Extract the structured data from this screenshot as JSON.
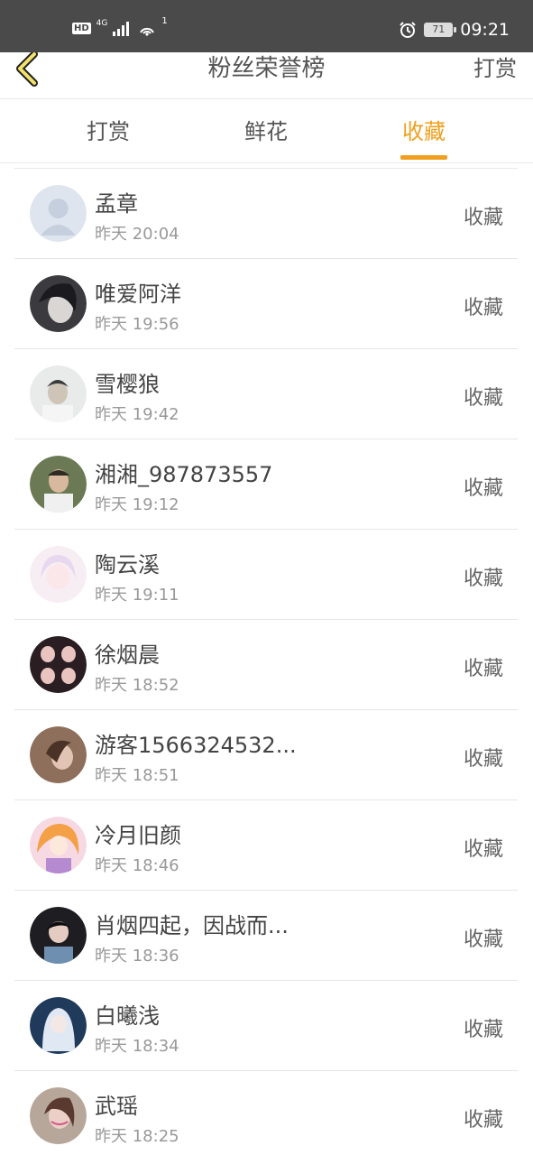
{
  "status_bar": {
    "network_badge": "HD",
    "network_type": "4G",
    "hotspot_count": "1",
    "battery_level": "71",
    "time": "09:21"
  },
  "nav": {
    "title": "粉丝荣誉榜",
    "right_action": "打赏"
  },
  "tabs": [
    {
      "label": "打赏",
      "active": false
    },
    {
      "label": "鲜花",
      "active": false
    },
    {
      "label": "收藏",
      "active": true
    }
  ],
  "accent_color": "#f0a01e",
  "list": [
    {
      "name": "孟章",
      "time": "昨天 20:04",
      "action": "收藏",
      "avatar": "default-avatar"
    },
    {
      "name": "唯爱阿洋",
      "time": "昨天 19:56",
      "action": "收藏",
      "avatar": "user-photo"
    },
    {
      "name": "雪樱狼",
      "time": "昨天 19:42",
      "action": "收藏",
      "avatar": "user-photo"
    },
    {
      "name": "湘湘_987873557",
      "time": "昨天 19:12",
      "action": "收藏",
      "avatar": "user-photo"
    },
    {
      "name": "陶云溪",
      "time": "昨天 19:11",
      "action": "收藏",
      "avatar": "user-photo"
    },
    {
      "name": "徐烟晨",
      "time": "昨天 18:52",
      "action": "收藏",
      "avatar": "user-photo"
    },
    {
      "name": "游客1566324532...",
      "time": "昨天 18:51",
      "action": "收藏",
      "avatar": "user-photo"
    },
    {
      "name": "冷月旧颜",
      "time": "昨天 18:46",
      "action": "收藏",
      "avatar": "user-photo"
    },
    {
      "name": "肖烟四起，因战而...",
      "time": "昨天 18:36",
      "action": "收藏",
      "avatar": "user-photo"
    },
    {
      "name": "白曦浅",
      "time": "昨天 18:34",
      "action": "收藏",
      "avatar": "user-photo"
    },
    {
      "name": "武瑶",
      "time": "昨天 18:25",
      "action": "收藏",
      "avatar": "user-photo"
    }
  ]
}
